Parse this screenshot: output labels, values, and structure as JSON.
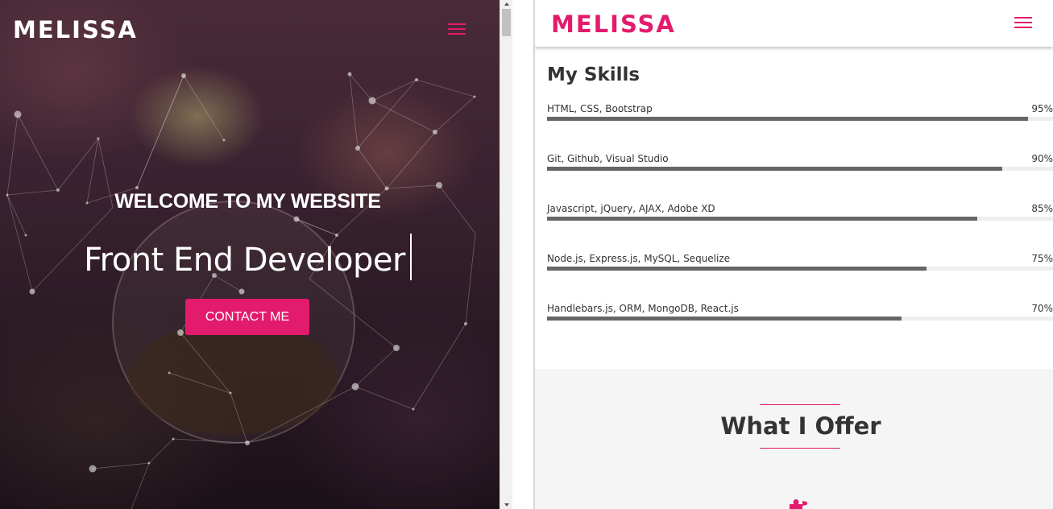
{
  "hero": {
    "logo": "MELISSA",
    "welcome": "WELCOME TO MY WEBSITE",
    "role": "Front End Developer",
    "contact_button": "CONTACT ME",
    "menu_icon": "hamburger-icon"
  },
  "right": {
    "logo": "MELISSA",
    "menu_icon": "hamburger-icon",
    "skills_title": "My Skills",
    "skills": [
      {
        "name": "HTML, CSS, Bootstrap",
        "percent_label": "95%",
        "percent": 95
      },
      {
        "name": "Git, Github, Visual Studio",
        "percent_label": "90%",
        "percent": 90
      },
      {
        "name": "Javascript, jQuery, AJAX, Adobe XD",
        "percent_label": "85%",
        "percent": 85
      },
      {
        "name": "Node.js, Express.js, MySQL, Sequelize",
        "percent_label": "75%",
        "percent": 75
      },
      {
        "name": "Handlebars.js, ORM, MongoDB, React.js",
        "percent_label": "70%",
        "percent": 70
      }
    ],
    "offer_title": "What I Offer",
    "offer_icon": "puzzle-icon"
  },
  "colors": {
    "accent": "#e31b6d",
    "text_dark": "#333333",
    "bar_fill": "#666666",
    "bar_track": "#eeeeee",
    "offer_bg": "#f5f5f5"
  }
}
